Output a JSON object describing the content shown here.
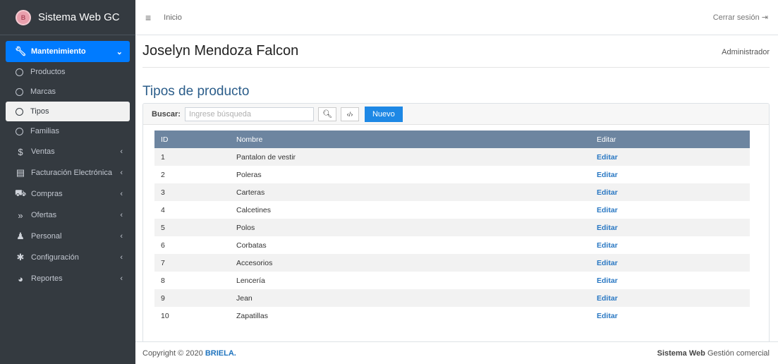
{
  "brand": {
    "name": "Sistema Web GC",
    "logo_text": "B"
  },
  "sidebar": {
    "active_group": "Mantenimiento",
    "sub_items": [
      "Productos",
      "Marcas",
      "Tipos",
      "Familias"
    ],
    "groups": [
      {
        "label": "Ventas",
        "icon": "dollar-icon",
        "glyph": "$"
      },
      {
        "label": "Facturación Electrónica",
        "icon": "invoice-icon",
        "glyph": "▤"
      },
      {
        "label": "Compras",
        "icon": "cart-icon",
        "glyph": "⛟"
      },
      {
        "label": "Ofertas",
        "icon": "tags-icon",
        "glyph": "»"
      },
      {
        "label": "Personal",
        "icon": "users-icon",
        "glyph": "♟"
      },
      {
        "label": "Configuración",
        "icon": "gear-icon",
        "glyph": "✱"
      },
      {
        "label": "Reportes",
        "icon": "pie-chart-icon",
        "glyph": "◕"
      }
    ]
  },
  "topnav": {
    "home": "Inicio",
    "logout": "Cerrar sesión"
  },
  "user": {
    "name": "Joselyn Mendoza Falcon",
    "role": "Administrador"
  },
  "page": {
    "title": "Tipos de producto"
  },
  "search": {
    "label": "Buscar:",
    "placeholder": "Ingrese búsqueda",
    "new_button": "Nuevo"
  },
  "table": {
    "columns": [
      "ID",
      "Nombre",
      "Editar"
    ],
    "rows": [
      {
        "id": "1",
        "name": "Pantalon de vestir",
        "action": "Editar"
      },
      {
        "id": "2",
        "name": "Poleras",
        "action": "Editar"
      },
      {
        "id": "3",
        "name": "Carteras",
        "action": "Editar"
      },
      {
        "id": "4",
        "name": "Calcetines",
        "action": "Editar"
      },
      {
        "id": "5",
        "name": "Polos",
        "action": "Editar"
      },
      {
        "id": "6",
        "name": "Corbatas",
        "action": "Editar"
      },
      {
        "id": "7",
        "name": "Accesorios",
        "action": "Editar"
      },
      {
        "id": "8",
        "name": "Lencería",
        "action": "Editar"
      },
      {
        "id": "9",
        "name": "Jean",
        "action": "Editar"
      },
      {
        "id": "10",
        "name": "Zapatillas",
        "action": "Editar"
      }
    ]
  },
  "footer": {
    "copyright": "Copyright © 2020",
    "company": "BRIELA.",
    "app_bold": "Sistema Web",
    "app_rest": "Gestión comercial"
  },
  "colors": {
    "sidebar_bg": "#343a40",
    "accent": "#007bff",
    "table_header": "#6d85a0",
    "link": "#2a78c3"
  }
}
